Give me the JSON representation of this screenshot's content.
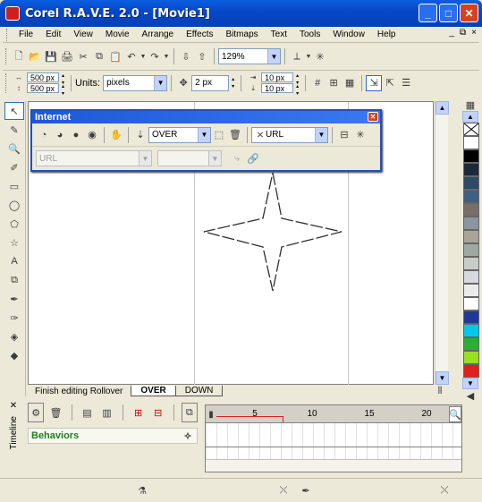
{
  "window": {
    "title": "Corel R.A.V.E. 2.0 - [Movie1]",
    "minimize": "_",
    "maximize": "□",
    "close": "✕"
  },
  "menu": [
    "File",
    "Edit",
    "View",
    "Movie",
    "Arrange",
    "Effects",
    "Bitmaps",
    "Text",
    "Tools",
    "Window",
    "Help"
  ],
  "mdi_controls": {
    "minimize": "_",
    "restore": "⧉",
    "close": "×"
  },
  "toolbar": {
    "zoom": "129%"
  },
  "property_bar": {
    "width": "500 px",
    "height": "500 px",
    "units_label": "Units:",
    "units_value": "pixels",
    "nudge": "2 px",
    "dup_x": "10 px",
    "dup_y": "10 px"
  },
  "internet_panel": {
    "title": "Internet",
    "state_value": "OVER",
    "url_target": "URL",
    "url_placeholder": "URL"
  },
  "state_tabs": {
    "finish": "Finish editing Rollover",
    "tabs": [
      "OVER",
      "DOWN"
    ]
  },
  "timeline": {
    "label": "Timeline",
    "behaviors": "Behaviors",
    "ruler": [
      "5",
      "10",
      "15",
      "20"
    ]
  },
  "palette": [
    "#ffffff",
    "#000000",
    "#1b2a3a",
    "#2e4a66",
    "#3f6080",
    "#7a6f68",
    "#8a95a0",
    "#a8a498",
    "#9fa8a4",
    "#c8ccc8",
    "#d8d8e0",
    "#ebebeb",
    "#ffffff",
    "#203898",
    "#00c8e8",
    "#28b030",
    "#98e020",
    "#e02020"
  ]
}
